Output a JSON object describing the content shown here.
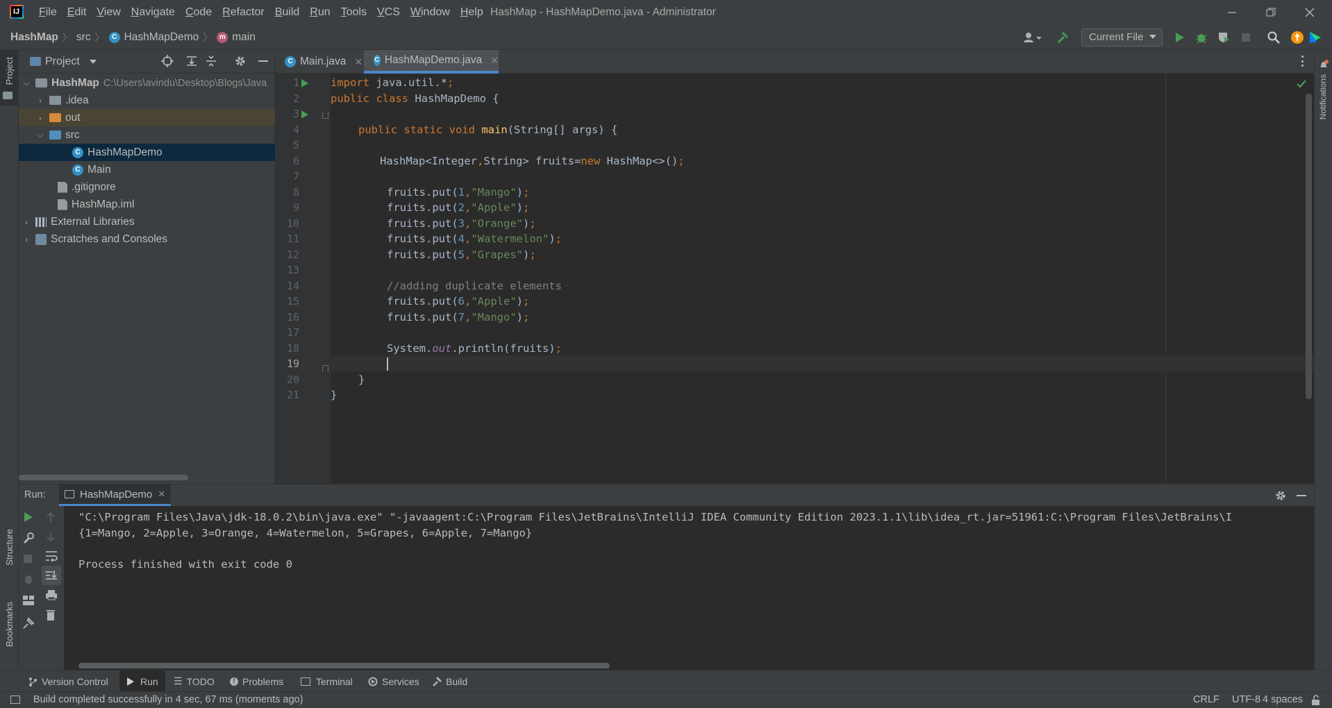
{
  "window": {
    "title": "HashMap - HashMapDemo.java - Administrator",
    "logo_text": "IJ",
    "menu": [
      "File",
      "Edit",
      "View",
      "Navigate",
      "Code",
      "Refactor",
      "Build",
      "Run",
      "Tools",
      "VCS",
      "Window",
      "Help"
    ]
  },
  "breadcrumb": {
    "project": "HashMap",
    "folder": "src",
    "class": "HashMapDemo",
    "method": "main"
  },
  "toolbar": {
    "run_config": "Current File"
  },
  "project_panel": {
    "title": "Project",
    "root_name": "HashMap",
    "root_path": "C:\\Users\\avindu\\Desktop\\Blogs\\Java",
    "items": [
      ".idea",
      "out",
      "src",
      "HashMapDemo",
      "Main",
      ".gitignore",
      "HashMap.iml",
      "External Libraries",
      "Scratches and Consoles"
    ]
  },
  "left_strip": {
    "project": "Project",
    "structure": "Structure",
    "bookmarks": "Bookmarks"
  },
  "right_strip": {
    "notifications": "Notifications"
  },
  "editor": {
    "tabs": [
      "Main.java",
      "HashMapDemo.java"
    ],
    "active_tab": "HashMapDemo.java",
    "line_numbers": [
      "1",
      "2",
      "3",
      "4",
      "5",
      "6",
      "7",
      "8",
      "9",
      "10",
      "11",
      "12",
      "13",
      "14",
      "15",
      "16",
      "17",
      "18",
      "19",
      "20",
      "21"
    ],
    "current_line": 19,
    "code": {
      "l1_kw": "import",
      "l1_rest": " java.util.*",
      "l1_semi": ";",
      "l2_kw": "public class",
      "l2_rest": " HashMapDemo {",
      "l4_kw": "public static void",
      "l4_fn": "main",
      "l4_rest": "(String[] args) {",
      "l6_a": "HashMap<Integer",
      "l6_comma": ",",
      "l6_b": "String> fruits=",
      "l6_new": "new",
      "l6_c": " HashMap<>()",
      "l6_semi": ";",
      "puts": [
        {
          "key": "1",
          "val": "\"Mango\""
        },
        {
          "key": "2",
          "val": "\"Apple\""
        },
        {
          "key": "3",
          "val": "\"Orange\""
        },
        {
          "key": "4",
          "val": "\"Watermelon\""
        },
        {
          "key": "5",
          "val": "\"Grapes\""
        }
      ],
      "comment": "//adding duplicate elements",
      "dups": [
        {
          "key": "6",
          "val": "\"Apple\""
        },
        {
          "key": "7",
          "val": "\"Mango\""
        }
      ],
      "put_prefix": "fruits.put(",
      "l18_a": "System.",
      "l18_out": "out",
      "l18_b": ".println(fruits)",
      "l18_semi": ";",
      "l20": "}",
      "l21": "}"
    }
  },
  "run_panel": {
    "label": "Run:",
    "tab": "HashMapDemo",
    "lines": [
      "\"C:\\Program Files\\Java\\jdk-18.0.2\\bin\\java.exe\" \"-javaagent:C:\\Program Files\\JetBrains\\IntelliJ IDEA Community Edition 2023.1.1\\lib\\idea_rt.jar=51961:C:\\Program Files\\JetBrains\\I",
      "{1=Mango, 2=Apple, 3=Orange, 4=Watermelon, 5=Grapes, 6=Apple, 7=Mango}",
      "",
      "Process finished with exit code 0"
    ]
  },
  "bottom_tabs": [
    "Version Control",
    "Run",
    "TODO",
    "Problems",
    "Terminal",
    "Services",
    "Build"
  ],
  "status": {
    "message": "Build completed successfully in 4 sec, 67 ms (moments ago)",
    "line_sep": "CRLF",
    "encoding": "UTF-8",
    "indent": "4 spaces"
  },
  "colors": {
    "accent": "#4a88c7",
    "keyword": "#cc7832",
    "string": "#6a8759",
    "number": "#6897bb",
    "run_green": "#499c54"
  }
}
